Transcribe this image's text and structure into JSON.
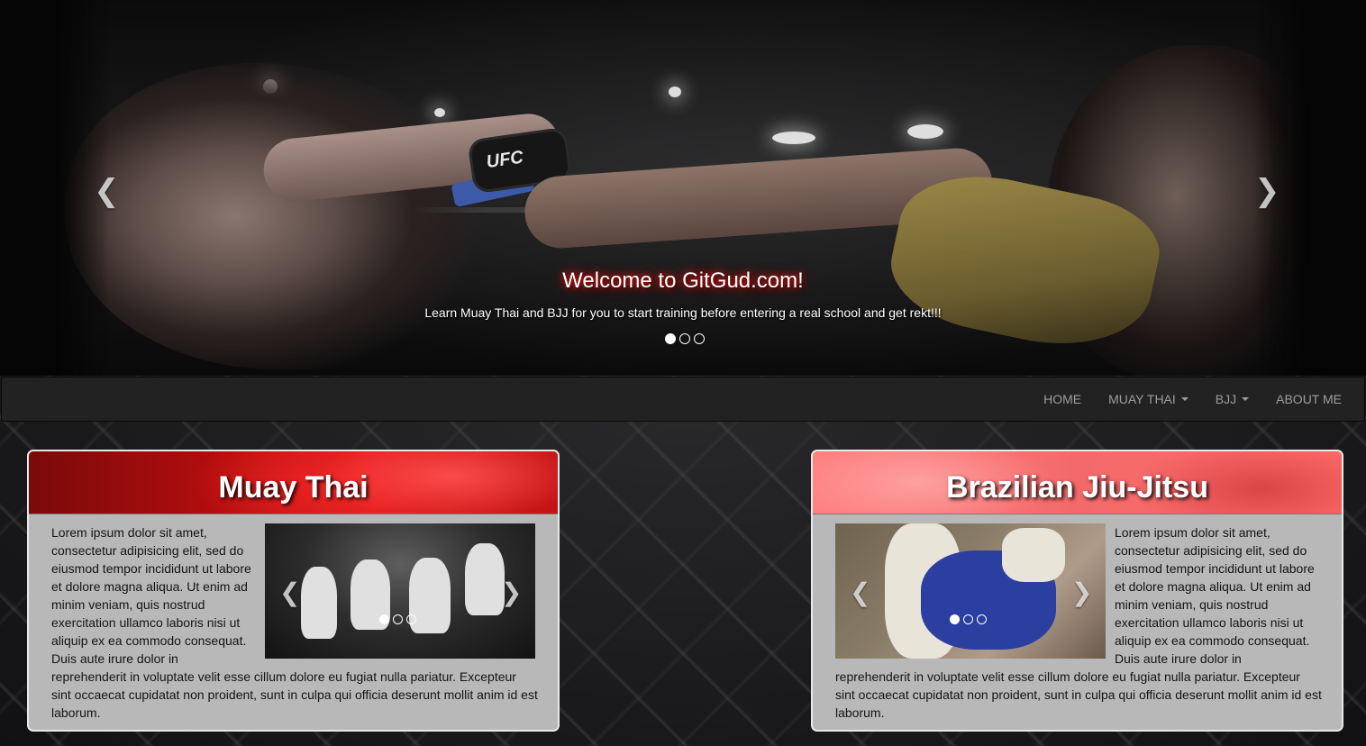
{
  "hero": {
    "title": "Welcome to GitGud.com!",
    "subtitle": "Learn Muay Thai and BJJ for you to start training before entering a real school and get rekt!!!",
    "glove_text": "UFC",
    "prev_icon": "chevron-left-icon",
    "next_icon": "chevron-right-icon",
    "slides": 3,
    "active_slide": 1
  },
  "navbar": {
    "items": [
      {
        "label": "HOME",
        "dropdown": false
      },
      {
        "label": "MUAY THAI",
        "dropdown": true
      },
      {
        "label": "BJJ",
        "dropdown": true
      },
      {
        "label": "ABOUT ME",
        "dropdown": false
      }
    ]
  },
  "panels": [
    {
      "title": "Muay Thai",
      "text_side": "Lorem ipsum dolor sit amet, consectetur adipisicing elit, sed do eiusmod tempor incididunt ut labore et dolore magna aliqua. Ut enim ad minim veniam, quis nostrud exercitation ullamco laboris nisi ut aliquip ex ea commodo consequat. Duis aute irure dolor in",
      "text_full": "reprehenderit in voluptate velit esse cillum dolore eu fugiat nulla pariatur. Excepteur sint occaecat cupidatat non proident, sunt in culpa qui officia deserunt mollit anim id est laborum.",
      "slides": 3,
      "active_slide": 1
    },
    {
      "title": "Brazilian Jiu-Jitsu",
      "text_side": "Lorem ipsum dolor sit amet, consectetur adipisicing elit, sed do eiusmod tempor incididunt ut labore et dolore magna aliqua. Ut enim ad minim veniam, quis nostrud exercitation ullamco laboris nisi ut aliquip ex ea commodo consequat. Duis aute irure dolor in",
      "text_full": "reprehenderit in voluptate velit esse cillum dolore eu fugiat nulla pariatur. Excepteur sint occaecat cupidatat non proident, sunt in culpa qui officia deserunt mollit anim id est laborum.",
      "slides": 3,
      "active_slide": 1
    }
  ],
  "colors": {
    "navbar_bg": "#222222",
    "nav_text": "#9d9d9d",
    "panel_body": "#b8b8b8",
    "muay_thai_header": "#c21414",
    "bjj_header": "#ff6b6b",
    "title_glow": "#ff1e1e"
  }
}
